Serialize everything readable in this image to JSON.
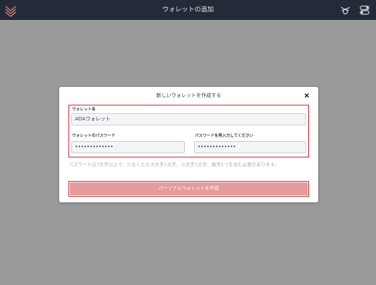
{
  "topbar": {
    "title": "ウォレットの追加",
    "logo_icon": "daedalus-logo-icon",
    "bug_icon": "bug-report-icon",
    "settings_icon": "settings-toggle-icon"
  },
  "dialog": {
    "title": "新しいウォレットを作成する",
    "close_icon": "close-icon",
    "wallet_name": {
      "label": "ウォレット名",
      "value": "ADAウォレット"
    },
    "password": {
      "label": "ウォレットのパスワード",
      "value": "•••••••••••••"
    },
    "repeat_password": {
      "label": "パスワードを再入力してください",
      "value": "•••••••••••••"
    },
    "hint": "パスワードは7文字以上で、少なくとも大文字1文字、小文字1文字、数字1つを含む必要があります。",
    "create_button": "パーソナルウォレットを作成"
  },
  "colors": {
    "topbar_bg": "#232b38",
    "overlay_bg": "#9a9a9a",
    "highlight_border": "#e0202a",
    "button_bg": "#e39b9b"
  }
}
